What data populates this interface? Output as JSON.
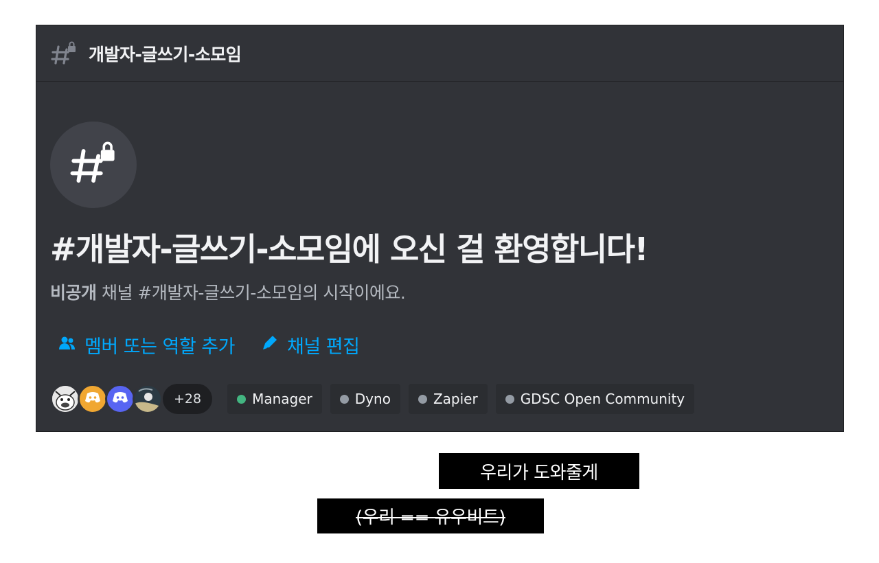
{
  "channel": {
    "name": "개발자-글쓰기-소모임",
    "icon": "hash-lock-icon"
  },
  "welcome": {
    "title": "#개발자-글쓰기-소모임에 오신 걸 환영합니다!",
    "subtitle_strong": "비공개",
    "subtitle_rest": " 채널 #개발자-글쓰기-소모임의 시작이에요."
  },
  "actions": {
    "add_members": "멤버 또는 역할 추가",
    "edit_channel": "채널 편집"
  },
  "members": {
    "more_count": "+28"
  },
  "roles": [
    {
      "label": "Manager",
      "color": "#43b581"
    },
    {
      "label": "Dyno",
      "color": "#949ba4"
    },
    {
      "label": "Zapier",
      "color": "#949ba4"
    },
    {
      "label": "GDSC Open Community",
      "color": "#949ba4"
    }
  ],
  "captions": {
    "line1": "우리가 도와줄게",
    "line2": "(우리 == 유우비트)"
  },
  "colors": {
    "background": "#313338",
    "link": "#00a8fc"
  }
}
